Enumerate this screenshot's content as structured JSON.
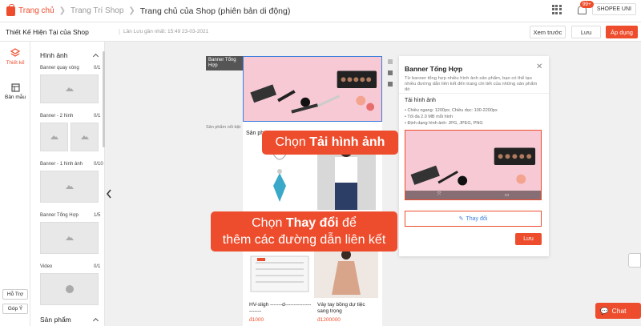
{
  "nav": {
    "logo_text": "Trang chủ",
    "crumbs": [
      "Trang Trí Shop"
    ],
    "current": "Trang chủ của Shop (phiên bản di động)",
    "notif_count": "99+",
    "shop_name": "SHOPEE UNI"
  },
  "editor": {
    "title": "Thiết Kế Hiện Tại của Shop",
    "last_saved": "Lần Lưu gần nhất: 15:49 23-03-2021",
    "preview": "Xem trước",
    "save": "Lưu",
    "apply": "Áp dụng"
  },
  "rail": {
    "design": "Thiết kế",
    "templates": "Bản mẫu",
    "help": "Hỗ Trợ",
    "feedback": "Góp Ý"
  },
  "panel": {
    "image_section": "Hình ảnh",
    "product_section": "Sản phẩm",
    "components": [
      {
        "label": "Banner quay vòng",
        "count": "0/1"
      },
      {
        "label": "Banner - 2 hình",
        "count": "0/1"
      },
      {
        "label": "Banner - 1 hình ảnh",
        "count": "0/10"
      },
      {
        "label": "Banner Tổng Hợp",
        "count": "1/5"
      },
      {
        "label": "Video",
        "count": "0/1"
      }
    ]
  },
  "canvas": {
    "tag_banner": "Banner Tổng Hợp",
    "tag_products": "Sản phẩm nổi bật",
    "products_label": "Sản ph",
    "products": [
      {
        "name": "HV-sligh -------d----------------------",
        "price": "đ1000"
      },
      {
        "name": "Váy tay bồng dự tiệc sang trọng",
        "price": "đ1200000"
      }
    ]
  },
  "drawer": {
    "title": "Banner Tổng Hợp",
    "desc": "Từ banner tổng hợp nhiều hình ảnh sản phẩm, bạn có thể tạo nhiều đường dẫn liên kết đến trang chi tiết của những sản phẩm đó",
    "upload_title": "Tải hình ảnh",
    "specs": [
      "Chiều ngang: 1200px; Chiều dọc: 100-2200px",
      "Tối đa 2.0 MB mỗi hình",
      "Định dạng hình ảnh: JPG, JPEG, PNG"
    ],
    "change": "Thay đổi",
    "save": "Lưu"
  },
  "callouts": {
    "c1_pre": "Chọn ",
    "c1_bold": "Tải hình ảnh",
    "c2_pre": "Chọn ",
    "c2_bold": "Thay đổi",
    "c2_post": " để",
    "c2_line2": "thêm các đường dẫn liên kết"
  },
  "chat": {
    "label": "Chat"
  },
  "colors": {
    "accent": "#ee4d2d",
    "link": "#3b7ddd"
  }
}
